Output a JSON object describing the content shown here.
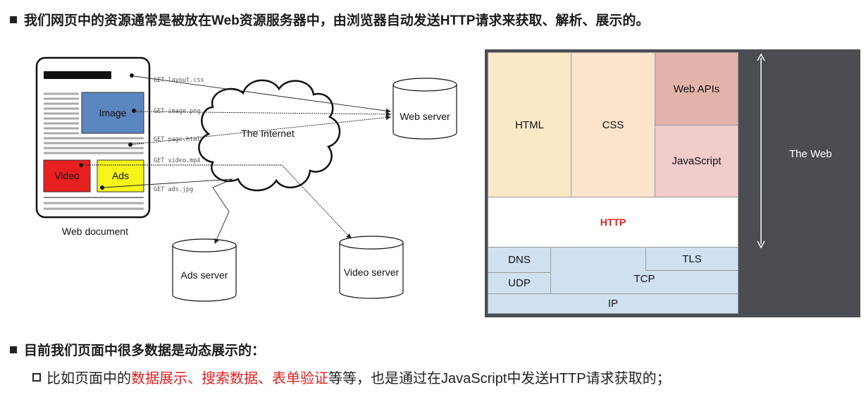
{
  "heading1": "我们网页中的资源通常是被放在Web资源服务器中，由浏览器自动发送HTTP请求来获取、解析、展示的。",
  "heading2": "目前我们页面中很多数据是动态展示的：",
  "sub": {
    "prefix": "比如页面中的",
    "red1": "数据展示、搜索数据、表单验证",
    "suffix": "等等，也是通过在JavaScript中发送HTTP请求获取的；"
  },
  "diagram": {
    "doc_image": "Image",
    "doc_video": "Video",
    "doc_ads": "Ads",
    "doc_label": "Web document",
    "internet": "The Internet",
    "web_server": "Web server",
    "ads_server": "Ads server",
    "video_server": "Video server",
    "req_layout": "GET layout.css",
    "req_image": "GET image.png",
    "req_page": "GET page.html",
    "req_video": "GET video.mp4",
    "req_ads": "GET ads.jpg"
  },
  "stack": {
    "html": "HTML",
    "css": "CSS",
    "webapis": "Web APIs",
    "javascript": "JavaScript",
    "http": "HTTP",
    "dns": "DNS",
    "udp": "UDP",
    "tls": "TLS",
    "tcp": "TCP",
    "ip": "IP",
    "theweb": "The Web"
  },
  "colors": {
    "html": "#fbe8c4",
    "css": "#fbe3cc",
    "webapis": "#e3b3aa",
    "javascript": "#f2cbcb",
    "http_text": "#e21f1f",
    "net": "#cfe1f1",
    "dark": "#4a4d52"
  }
}
